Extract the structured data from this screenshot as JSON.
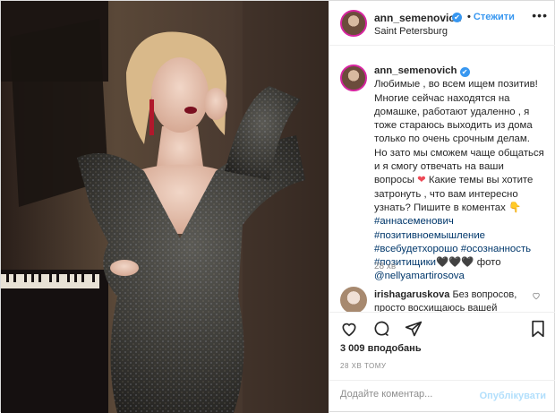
{
  "post": {
    "author": "ann_semenovich",
    "verified_icon": "✔",
    "follow_label": "Стежити",
    "location": "Saint Petersburg",
    "more_label": "•••"
  },
  "caption": {
    "author": "ann_semenovich",
    "text_1": "Любимые , во всем ищем позитив! Многие сейчас находятся на домашке, работают удаленно , я тоже стараюсь выходить из дома только по очень срочным делам. Но зато мы сможем чаще общаться и я смогу отвечать на ваши вопросы",
    "heart_emoji": "❤",
    "text_2": "Какие темы вы хотите затронуть , что вам интересно узнать? Пишите в коментах",
    "hand_emoji": "👇",
    "tags_1": "#аннасеменович #позитивноемышление #всебудетхорошо #осознанность #позитищики",
    "hearts_emoji": "🖤🖤🖤",
    "photo_label": "фото",
    "mention": "@nellyamartirosova",
    "time": "28 хв"
  },
  "comment": {
    "author": "irishagaruskova",
    "text": "Без вопросов, просто восхищаюсь вашей",
    "like_icon": "heart-outline"
  },
  "actions": {
    "like_icon": "heart-outline",
    "comment_icon": "speech-bubble",
    "share_icon": "paper-plane",
    "save_icon": "bookmark"
  },
  "likes": "3 009 вподобань",
  "date": "28 ХВ ТОМУ",
  "add_comment": {
    "placeholder": "Додайте коментар...",
    "publish_label": "Опублікувати"
  },
  "colors": {
    "link": "#3897f0",
    "hashtag": "#00376b",
    "muted": "#8e8e8e",
    "border": "#efefef",
    "publish_disabled": "#b2dffc"
  }
}
